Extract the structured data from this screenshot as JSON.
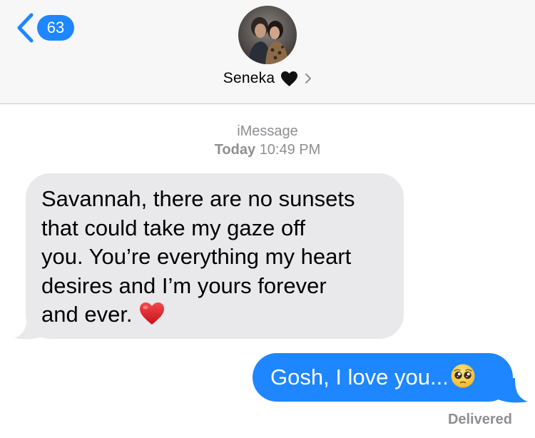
{
  "header": {
    "back_count": "63",
    "contact_name": "Seneka",
    "name_heart_icon": "black-heart-icon",
    "back_icon": "chevron-left-icon",
    "info_icon": "chevron-right-icon"
  },
  "thread": {
    "service": "iMessage",
    "day": "Today",
    "time": "10:49 PM"
  },
  "messages": [
    {
      "direction": "incoming",
      "lines": [
        "Savannah, there are no sunsets",
        "that could take my gaze off",
        "you. You’re everything my heart",
        "desires and I’m yours forever",
        "and ever."
      ],
      "emoji": "red-heart-emoji"
    },
    {
      "direction": "outgoing",
      "text": "Gosh, I love you...",
      "emoji": "pleading-face-emoji"
    }
  ],
  "status": "Delivered",
  "colors": {
    "accent_blue": "#1e86ff",
    "incoming_bubble": "#e9e9eb",
    "header_bg": "#f7f7f7",
    "meta_gray": "#8e8e93"
  }
}
